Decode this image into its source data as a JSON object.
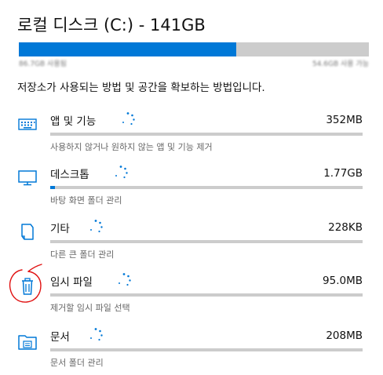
{
  "header": {
    "title": "로컬 디스크 (C:) - 141GB",
    "used_fraction": 0.62,
    "used_label": "86.7GB 사용됨",
    "free_label": "54.6GB 사용 가능"
  },
  "description": "저장소가 사용되는 방법 및 공간을 확보하는 방법입니다.",
  "categories": [
    {
      "name": "앱 및 기능",
      "size": "352MB",
      "subtitle": "사용하지 않거나 원하지 않는 앱 및 기능 제거",
      "icon": "keyboard-icon",
      "fill_fraction": 0.0
    },
    {
      "name": "데스크톱",
      "size": "1.77GB",
      "subtitle": "바탕 화면 폴더 관리",
      "icon": "desktop-monitor-icon",
      "fill_fraction": 0.015
    },
    {
      "name": "기타",
      "size": "228KB",
      "subtitle": "다른 큰 폴더 관리",
      "icon": "document-other-icon",
      "fill_fraction": 0.0
    },
    {
      "name": "임시 파일",
      "size": "95.0MB",
      "subtitle": "제거할 임시 파일 선택",
      "icon": "trash-icon",
      "fill_fraction": 0.0
    },
    {
      "name": "문서",
      "size": "208MB",
      "subtitle": "문서 폴더 관리",
      "icon": "documents-folder-icon",
      "fill_fraction": 0.0
    }
  ],
  "colors": {
    "accent": "#0078d7",
    "track": "#cccccc",
    "annotation": "#e01010"
  }
}
